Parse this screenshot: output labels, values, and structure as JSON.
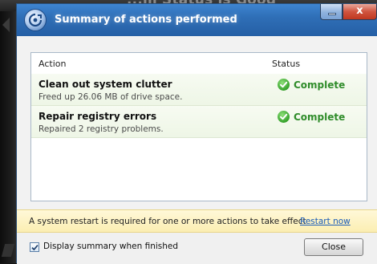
{
  "background": {
    "heading": "...m Status is Good"
  },
  "window": {
    "title": "Summary of actions performed",
    "controls": {
      "minimize": "minimize",
      "close": "x"
    }
  },
  "table": {
    "columns": {
      "action": "Action",
      "status": "Status"
    },
    "rows": [
      {
        "title": "Clean out system clutter",
        "detail": "Freed up 26.06 MB of drive space.",
        "status": "Complete"
      },
      {
        "title": "Repair registry errors",
        "detail": "Repaired 2 registry problems.",
        "status": "Complete"
      }
    ]
  },
  "notice": {
    "text": "A system restart is required for one or more actions to take effect",
    "link": "Restart now"
  },
  "footer": {
    "checkbox_label": "Display summary when finished",
    "checkbox_checked": true,
    "close_button": "Close"
  },
  "colors": {
    "title_bar": "#2f6fb7",
    "status_complete": "#2f8c2a",
    "link": "#1a5bb8",
    "notice_bg": "#fbeeb2"
  },
  "icons": {
    "app": "app-logo-icon",
    "status": "check-icon"
  }
}
